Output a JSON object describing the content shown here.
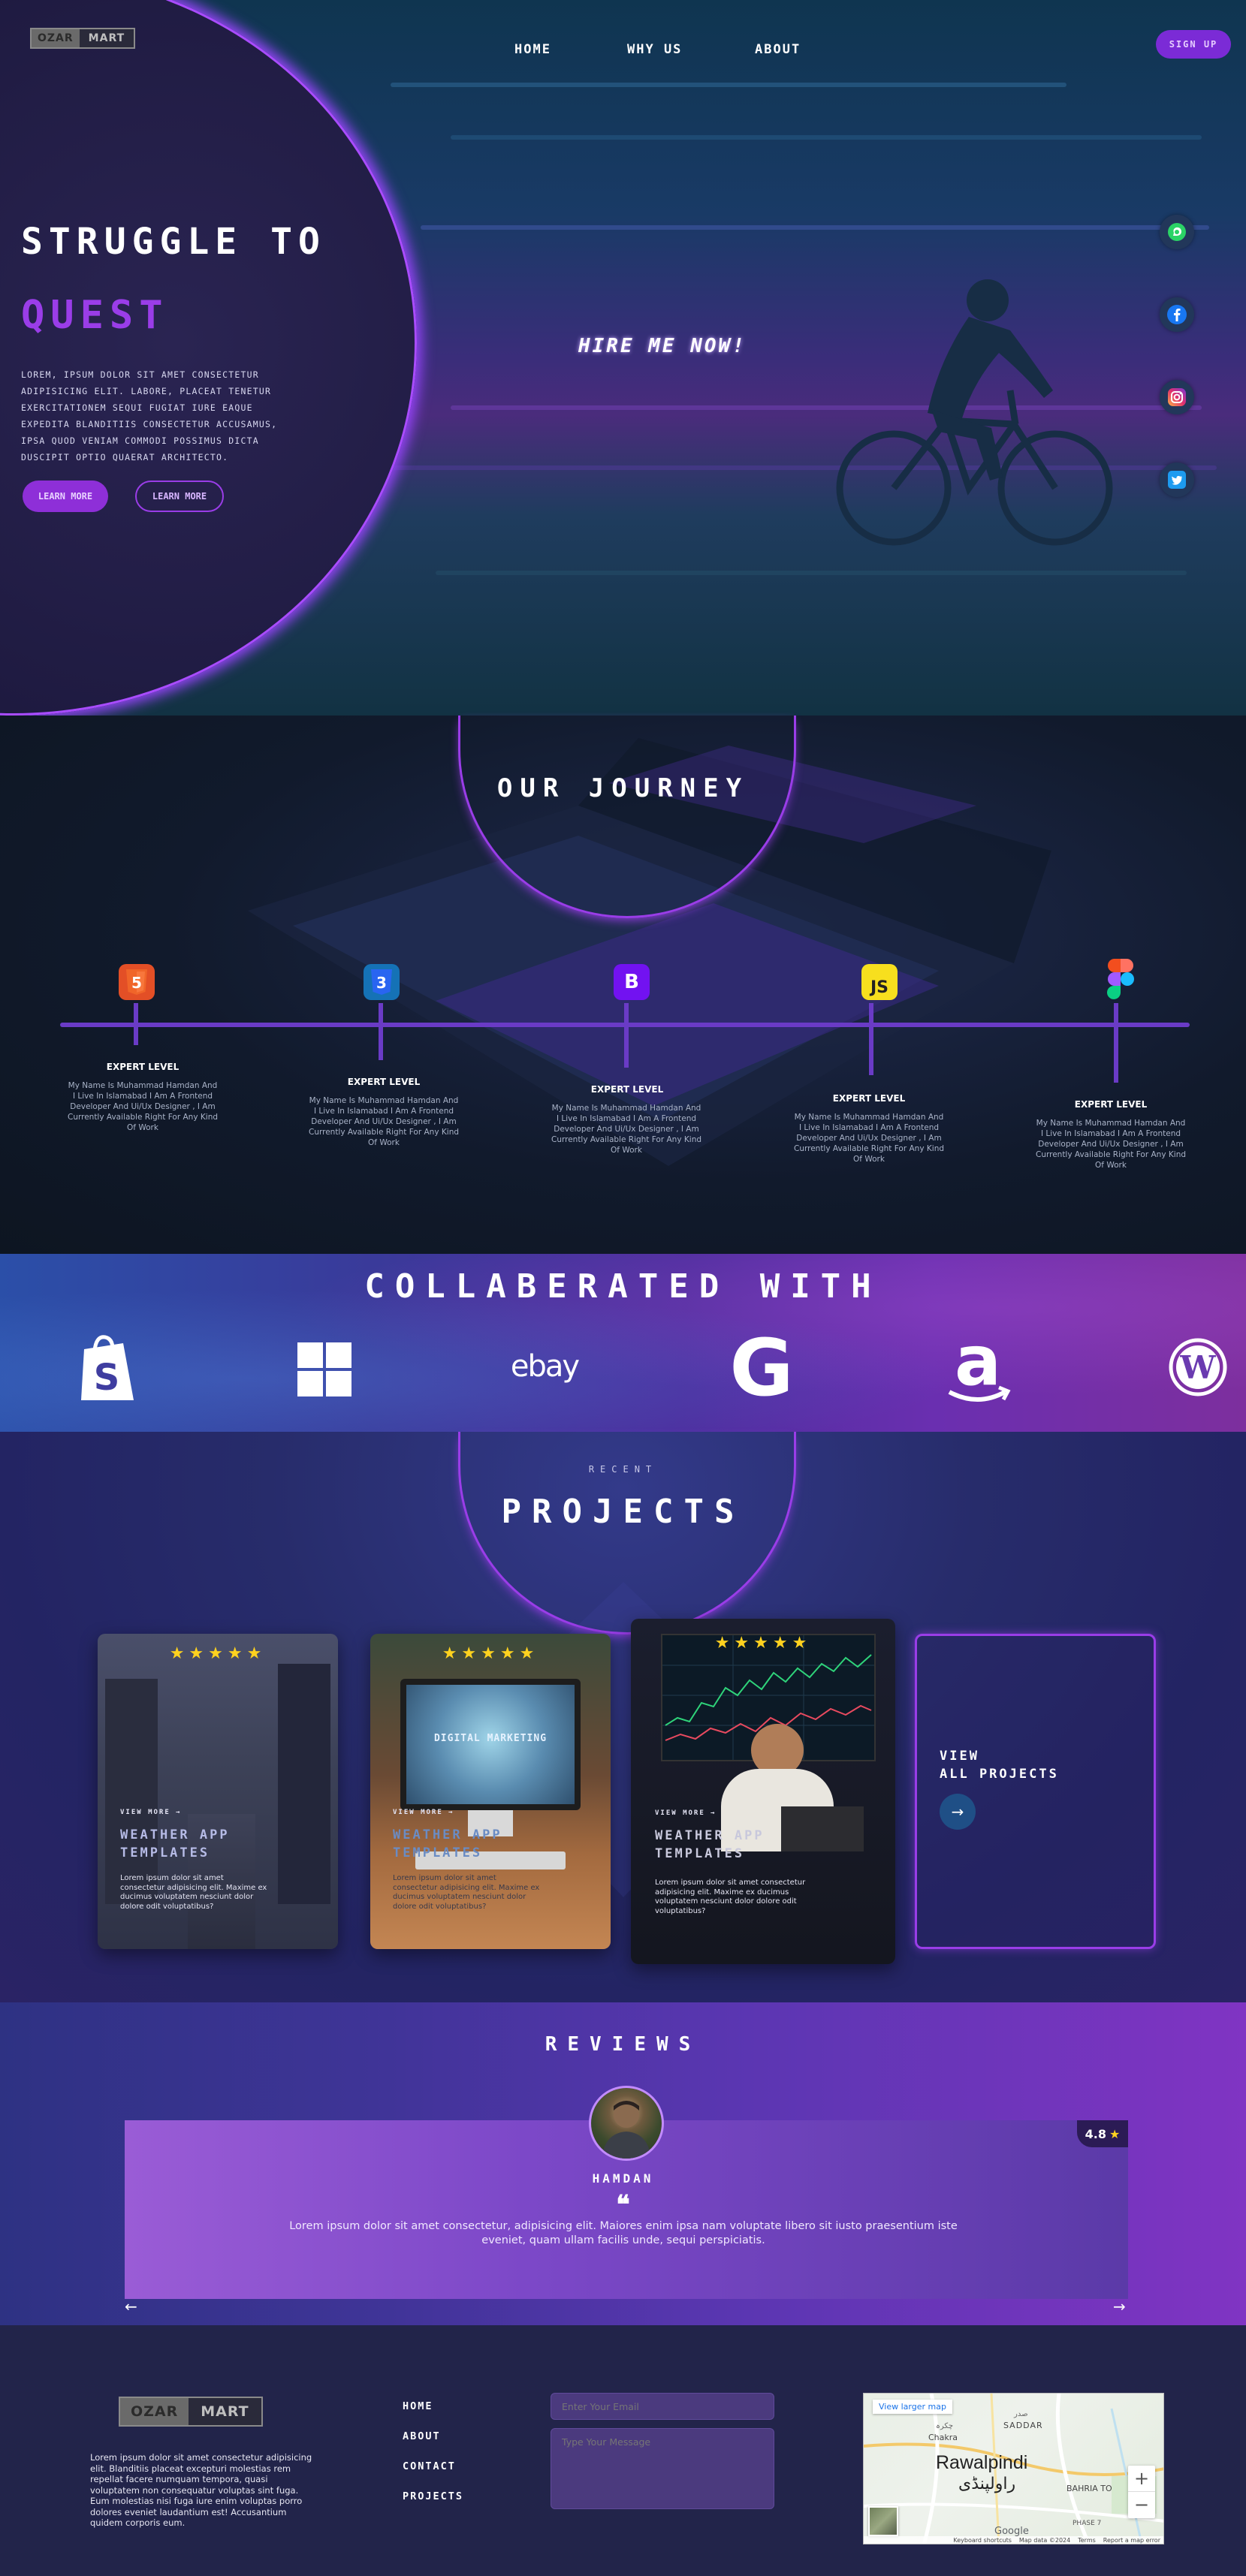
{
  "colors": {
    "accent": "#9a3de8",
    "hero_dark": "#1e1a40",
    "journey_bg": "#111a2c",
    "footer_bg": "#22244a",
    "star": "#ffd21f"
  },
  "logo": {
    "part1": "OZAR",
    "part2": "MART"
  },
  "nav": {
    "items": [
      "HOME",
      "WHY US",
      "ABOUT"
    ],
    "signup": "SIGN UP"
  },
  "hero": {
    "title_line1": "STRUGGLE TO",
    "title_line2": "QUEST",
    "body": "LOREM, IPSUM DOLOR SIT AMET CONSECTETUR ADIPISICING ELIT. LABORE, PLACEAT TENETUR EXERCITATIONEM SEQUI FUGIAT IURE EAQUE EXPEDITA BLANDITIIS CONSECTETUR ACCUSAMUS, IPSA QUOD VENIAM COMMODI POSSIMUS DICTA DUSCIPIT OPTIO QUAERAT ARCHITECTO.",
    "button1": "LEARN MORE",
    "button2": "LEARN MORE",
    "tagline": "HIRE ME NOW!",
    "social_icons": [
      "whatsapp-icon",
      "facebook-icon",
      "instagram-icon",
      "twitter-icon"
    ]
  },
  "journey": {
    "title": "OUR JOURNEY",
    "items": [
      {
        "icon": "html5-icon",
        "glyph": "5",
        "level": "EXPERT LEVEL",
        "desc": "My Name Is Muhammad Hamdan And I Live In Islamabad I Am A Frontend Developer And Ui/Ux Designer , I Am Currently Available Right For Any Kind Of Work"
      },
      {
        "icon": "css3-icon",
        "glyph": "3",
        "level": "EXPERT LEVEL",
        "desc": "My Name Is Muhammad Hamdan And I Live In Islamabad I Am A Frontend Developer And Ui/Ux Designer , I Am Currently Available Right For Any Kind Of Work"
      },
      {
        "icon": "bootstrap-icon",
        "glyph": "B",
        "level": "EXPERT LEVEL",
        "desc": "My Name Is Muhammad Hamdan And I Live In Islamabad I Am A Frontend Developer And Ui/Ux Designer , I Am Currently Available Right For Any Kind Of Work"
      },
      {
        "icon": "javascript-icon",
        "glyph": "JS",
        "level": "EXPERT LEVEL",
        "desc": "My Name Is Muhammad Hamdan And I Live In Islamabad I Am A Frontend Developer And Ui/Ux Designer , I Am Currently Available Right For Any Kind Of Work"
      },
      {
        "icon": "figma-icon",
        "glyph": "",
        "level": "EXPERT LEVEL",
        "desc": "My Name Is Muhammad Hamdan And I Live In Islamabad I Am A Frontend Developer And Ui/Ux Designer , I Am Currently Available Right For Any Kind Of Work"
      }
    ]
  },
  "collab": {
    "title": "COLLABERATED WITH",
    "brands": [
      {
        "icon": "shopify-icon",
        "text": "S"
      },
      {
        "icon": "windows-icon",
        "text": ""
      },
      {
        "icon": "ebay-icon",
        "text": "ebay"
      },
      {
        "icon": "google-icon",
        "text": "G"
      },
      {
        "icon": "amazon-icon",
        "text": "a"
      },
      {
        "icon": "wordpress-icon",
        "text": "W"
      }
    ]
  },
  "projects": {
    "subtitle": "RECENT",
    "title": "PROJECTS",
    "stars": "★★★★★",
    "cards": [
      {
        "view": "VIEW MORE →",
        "title": "WEATHER APP TEMPLATES",
        "desc": "Lorem ipsum dolor sit amet consectetur adipisicing elit. Maxime ex ducimus voluptatem nesciunt dolor dolore odit voluptatibus?"
      },
      {
        "view": "VIEW MORE →",
        "title": "WEATHER APP TEMPLATES",
        "desc": "Lorem ipsum dolor sit amet consectetur adipisicing elit. Maxime ex ducimus voluptatem nesciunt dolor dolore odit voluptatibus?",
        "screen_text": "DIGITAL MARKETING"
      },
      {
        "view": "VIEW MORE →",
        "title": "WEATHER APP TEMPLATES",
        "desc": "Lorem ipsum dolor sit amet consectetur adipisicing elit. Maxime ex ducimus voluptatem nesciunt dolor dolore odit voluptatibus?"
      }
    ],
    "view_all": {
      "line1": "VIEW",
      "line2": "ALL PROJECTS",
      "arrow": "→"
    }
  },
  "reviews": {
    "title": "REVIEWS",
    "rating": "4.8",
    "rating_star": "★",
    "name": "HAMDAN",
    "quote_mark": "❝",
    "text": "Lorem ipsum dolor sit amet consectetur, adipisicing elit. Maiores enim ipsa nam voluptate libero sit iusto praesentium iste eveniet, quam ullam facilis unde, sequi perspiciatis.",
    "prev": "←",
    "next": "→"
  },
  "footer": {
    "about": "Lorem ipsum dolor sit amet consectetur adipisicing elit. Blanditiis placeat excepturi molestias rem repellat facere numquam tempora, quasi voluptatem non consequatur voluptas sint fuga. Eum molestias nisi fuga iure enim voluptas porro dolores eveniet laudantium est! Accusantium quidem corporis eum.",
    "links": [
      "HOME",
      "ABOUT",
      "CONTACT",
      "PROJECTS"
    ],
    "email_placeholder": "Enter Your Email",
    "message_placeholder": "Type Your Message",
    "map": {
      "view_larger": "View larger map",
      "city": "Rawalpindi",
      "city_urdu": "راولپنڈی",
      "labels": [
        "Chakra",
        "چکرہ",
        "SADDAR",
        "صدر",
        "BAHRIA TO",
        "PHASE 7"
      ],
      "google": "Google",
      "footer_items": [
        "Keyboard shortcuts",
        "Map data ©2024",
        "Terms",
        "Report a map error"
      ],
      "zoom_in": "+",
      "zoom_out": "−"
    }
  }
}
